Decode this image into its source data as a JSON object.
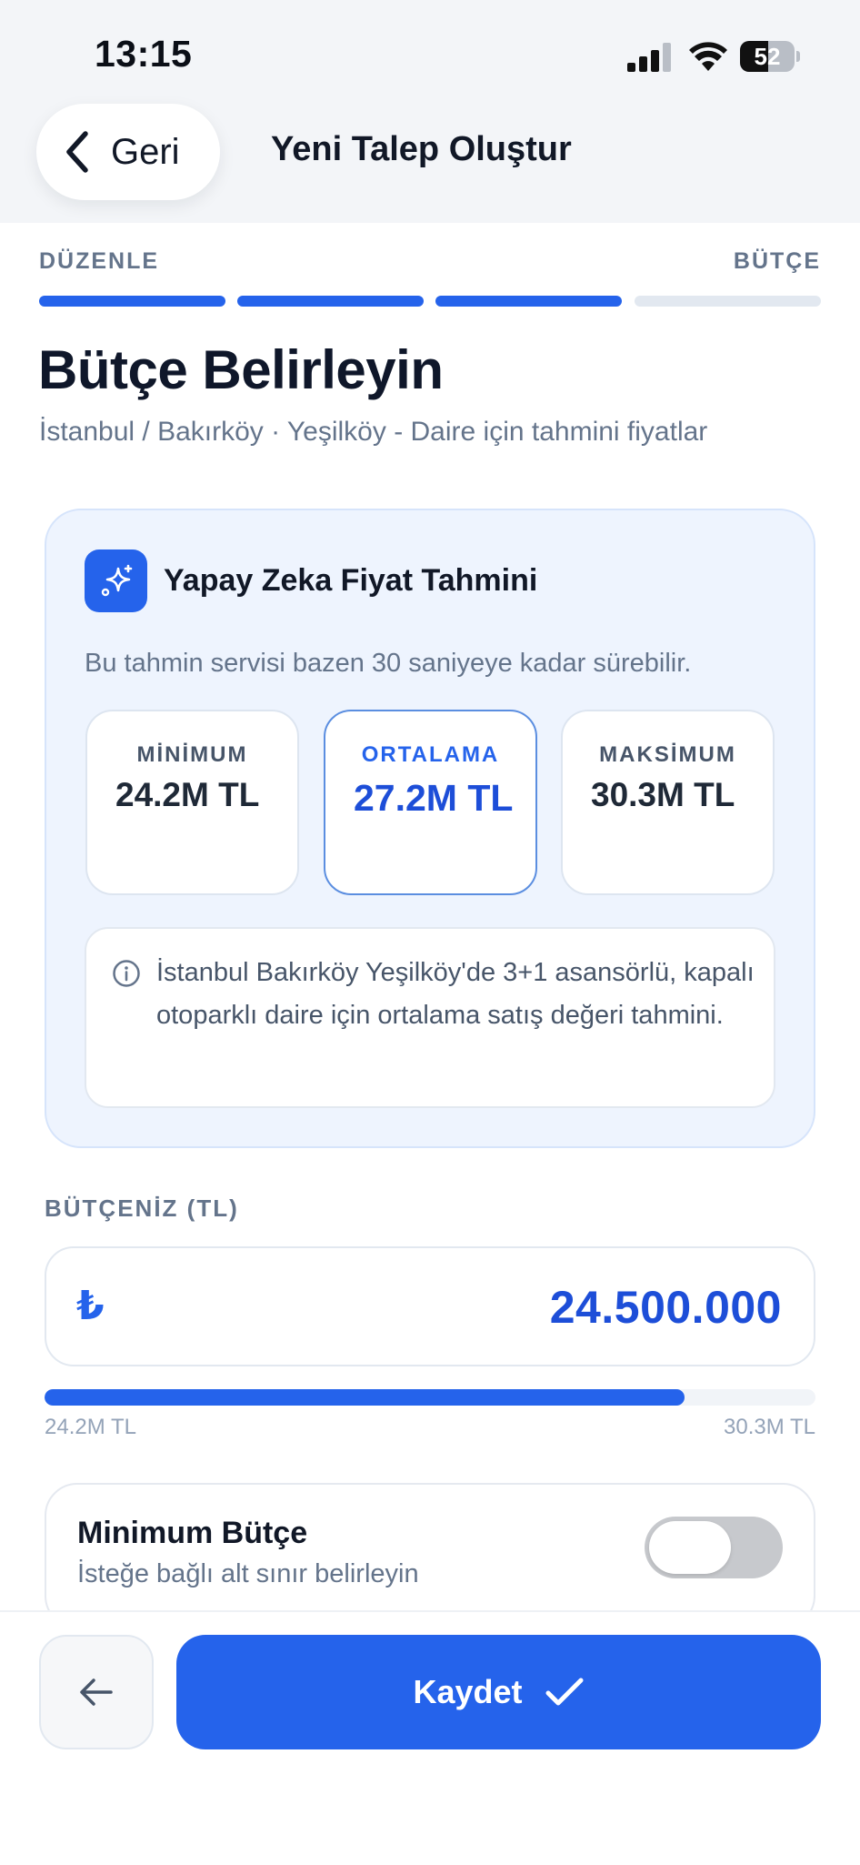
{
  "status_bar": {
    "time": "13:15",
    "battery": "52",
    "battery_level": 0.52
  },
  "header": {
    "back_label": "Geri",
    "title": "Yeni Talep Oluştur"
  },
  "stepper": {
    "left_label": "DÜZENLE",
    "right_label": "BÜTÇE",
    "total_steps": 4,
    "completed_steps": 3
  },
  "page": {
    "title": "Bütçe Belirleyin",
    "subtitle": "İstanbul / Bakırköy · Yeşilköy - Daire için tahmini fiyatlar"
  },
  "ai_estimate": {
    "title": "Yapay Zeka Fiyat Tahmini",
    "note": "Bu tahmin servisi bazen 30 saniyeye kadar sürebilir.",
    "cards": [
      {
        "label": "MİNİMUM",
        "value": "24.2M TL",
        "active": false
      },
      {
        "label": "ORTALAMA",
        "value": "27.2M TL",
        "active": true
      },
      {
        "label": "MAKSİMUM",
        "value": "30.3M TL",
        "active": false
      }
    ],
    "info_text": "İstanbul Bakırköy Yeşilköy'de 3+1 asansörlü, kapalı otoparklı daire için ortalama satış değeri tahmini."
  },
  "budget": {
    "label": "BÜTÇENİZ (TL)",
    "currency_symbol": "₺",
    "value": "24.500.000",
    "range_min_label": "24.2M TL",
    "range_max_label": "30.3M TL",
    "slider_fraction": 0.83
  },
  "min_budget": {
    "title": "Minimum Bütçe",
    "subtitle": "İsteğe bağlı alt sınır belirleyin",
    "enabled": false
  },
  "footer": {
    "save_label": "Kaydet"
  },
  "colors": {
    "primary": "#2563eb",
    "primary_dark": "#1d4ed8",
    "card_bg": "#eef4fe",
    "muted_text": "#64748b"
  },
  "icons": {
    "back": "chevron-left-icon",
    "ai": "sparkles-icon",
    "info": "info-circle-icon",
    "nav_back": "arrow-left-icon",
    "save": "check-icon"
  }
}
